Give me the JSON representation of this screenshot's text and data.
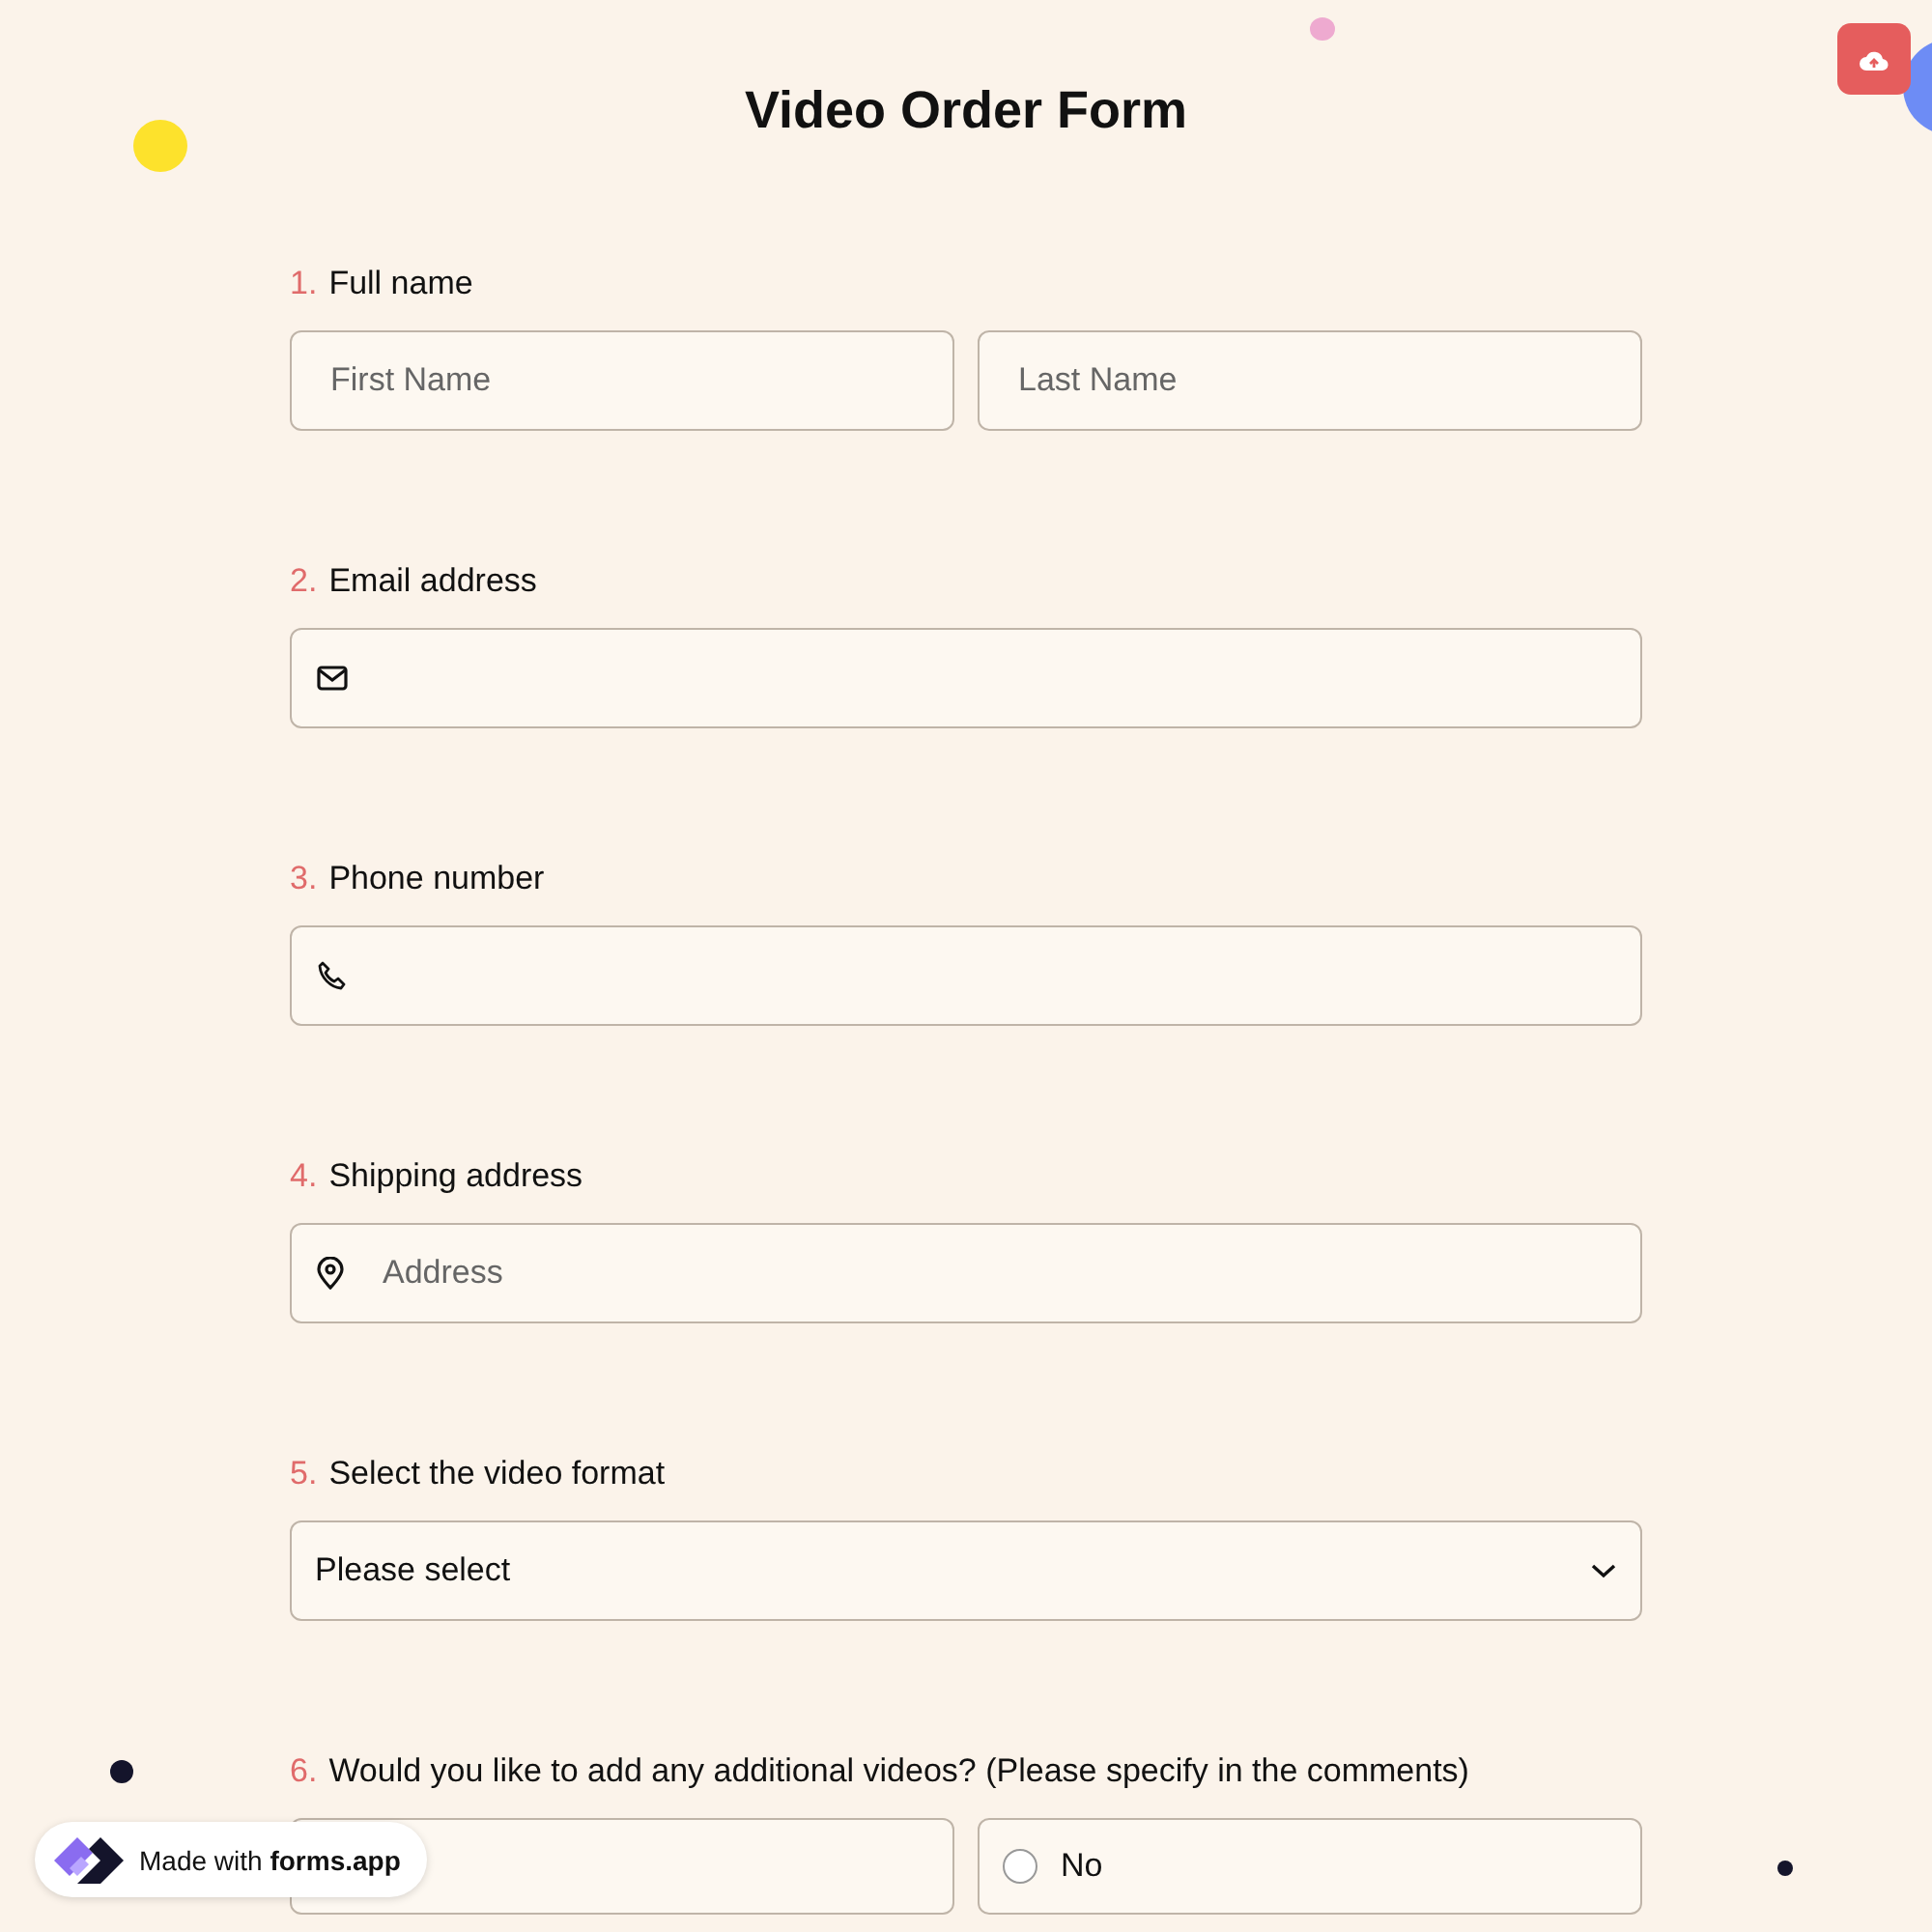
{
  "title": "Video Order Form",
  "questions": [
    {
      "number": "1.",
      "label": "Full name",
      "kind": "name",
      "fields": [
        {
          "placeholder": "First Name"
        },
        {
          "placeholder": "Last Name"
        }
      ]
    },
    {
      "number": "2.",
      "label": "Email address",
      "kind": "email"
    },
    {
      "number": "3.",
      "label": "Phone number",
      "kind": "phone"
    },
    {
      "number": "4.",
      "label": "Shipping address",
      "kind": "address",
      "placeholder": "Address"
    },
    {
      "number": "5.",
      "label": "Select the video format",
      "kind": "select",
      "value": "Please select"
    },
    {
      "number": "6.",
      "label": "Would you like to add any additional videos? (Please specify in the comments)",
      "kind": "radio",
      "options": [
        {
          "kind": "covered"
        },
        {
          "kind": "radio",
          "label": "No",
          "selected": false
        }
      ]
    }
  ],
  "badge": {
    "prefix": "Made with",
    "brand": "forms.app"
  }
}
